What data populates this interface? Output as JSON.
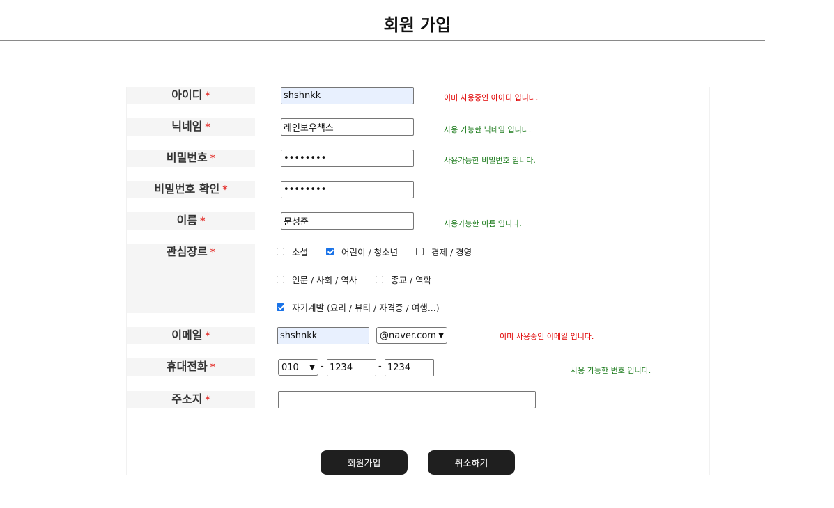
{
  "page": {
    "title": "회원 가입"
  },
  "required_mark": "*",
  "fields": {
    "userid": {
      "label": "아이디",
      "value": "shshnkk",
      "message": "이미 사용중인 아이디 입니다."
    },
    "nickname": {
      "label": "닉네임",
      "value": "레인보우책스",
      "message": "사용 가능한 닉네임 입니다."
    },
    "password": {
      "label": "비밀번호",
      "value": "12345678",
      "message": "사용가능한 비밀번호 입니다."
    },
    "password_confirm": {
      "label": "비밀번호 확인",
      "value": "12345678"
    },
    "name": {
      "label": "이름",
      "value": "문성준",
      "message": "사용가능한 이름 입니다."
    },
    "genre": {
      "label": "관심장르",
      "options": [
        {
          "label": "소설",
          "checked": false
        },
        {
          "label": "어린이 / 청소년",
          "checked": true
        },
        {
          "label": "경제 / 경영",
          "checked": false
        },
        {
          "label": "인문 / 사회 / 역사",
          "checked": false
        },
        {
          "label": "종교 / 역학",
          "checked": false
        },
        {
          "label": "자기계발 (요리 / 뷰티 / 자격증 / 여행...)",
          "checked": true
        }
      ]
    },
    "email": {
      "label": "이메일",
      "value": "shshnkk",
      "domain": "@naver.com",
      "message": "이미 사용중인 이메일 입니다."
    },
    "phone": {
      "label": "휴대전화",
      "prefix": "010",
      "middle": "1234",
      "last": "1234",
      "separator": "-",
      "message": "사용 가능한 번호 입니다."
    },
    "address": {
      "label": "주소지",
      "value": ""
    }
  },
  "buttons": {
    "submit": "회원가입",
    "cancel": "취소하기"
  },
  "colors": {
    "error": "#e00000",
    "ok": "#1a7a1a",
    "required": "#e53935",
    "button": "#1f1f1f",
    "autofill": "#e8f0fe"
  }
}
